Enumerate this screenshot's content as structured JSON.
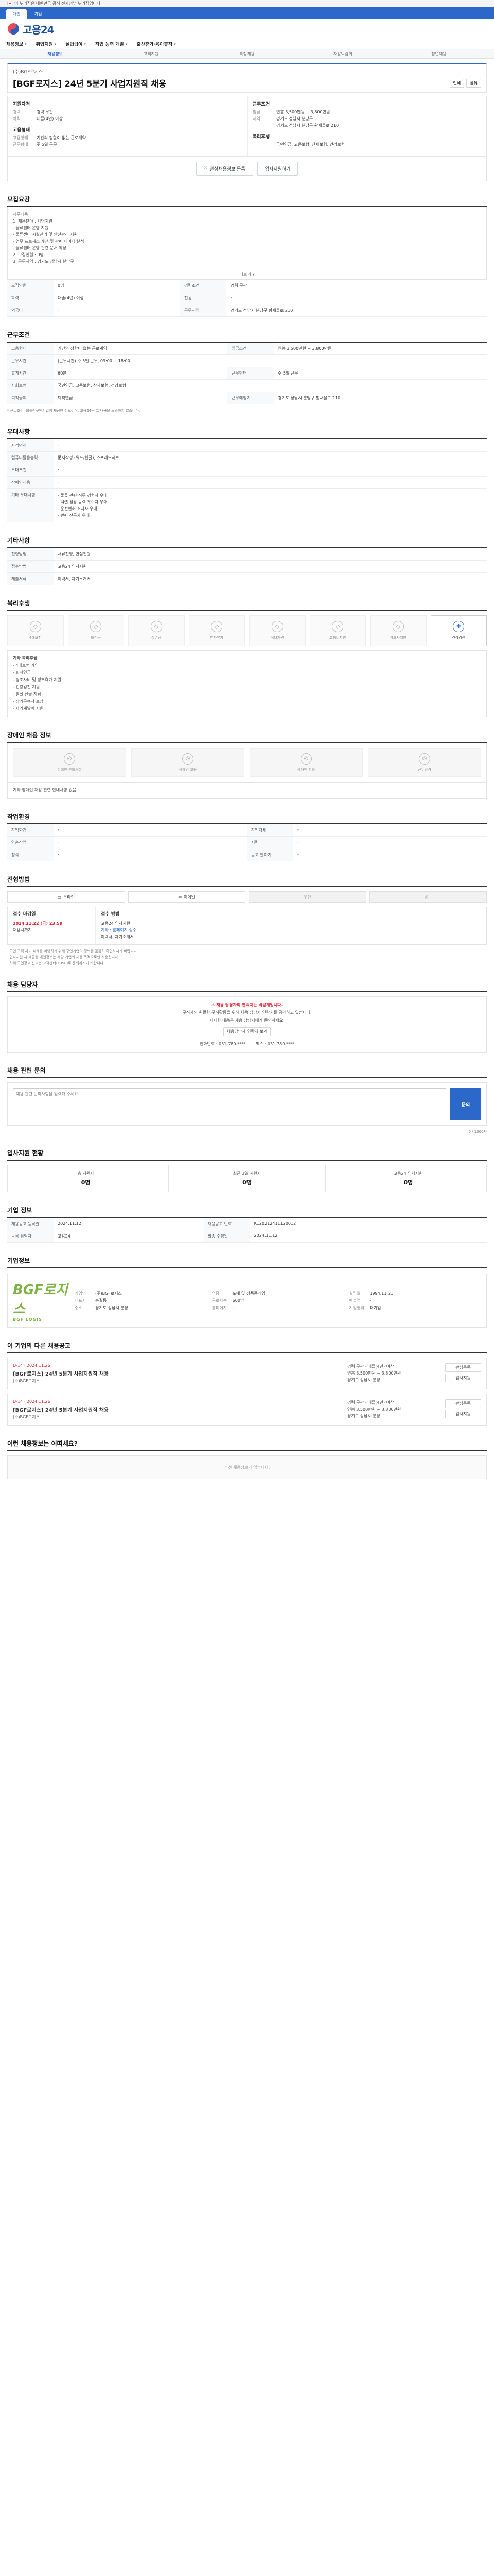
{
  "gov_banner": "이 누리집은 대한민국 공식 전자정부 누리집입니다.",
  "topnav": [
    "개인",
    "기업"
  ],
  "brand": {
    "logo_text": "고용24"
  },
  "mainmenu": [
    "채용정보",
    "취업지원",
    "실업급여",
    "직업 능력 개발",
    "출산휴가·육아휴직"
  ],
  "submenu": [
    "채용정보",
    "고객지원",
    "특정채용",
    "채용박람회",
    "청년채용"
  ],
  "job": {
    "company": "(주)BGF로지스",
    "title": "[BGF로지스] 24년 5분기 사업지원직 채용",
    "print": "인쇄",
    "share": "공유",
    "summary_left_title": "지원자격",
    "summary_left": [
      {
        "k": "경력",
        "v": "경력 무관"
      },
      {
        "k": "학력",
        "v": "대졸(4년) 이상"
      }
    ],
    "summary_right_title": "근무조건",
    "summary_right": [
      {
        "k": "임금",
        "v": "연봉 3,500만원 ~ 3,800만원"
      },
      {
        "k": "지역",
        "v": "경기도 성남시 분당구"
      },
      {
        "k": "",
        "v": "경기도 성남시 분당구 황새울로 210"
      }
    ],
    "summary_left2_title": "고용형태",
    "summary_left2": [
      {
        "k": "고용형태",
        "v": "기간의 정함이 없는 근로계약"
      },
      {
        "k": "근무형태",
        "v": "주 5일 근무"
      }
    ],
    "summary_right2_title": "복리후생",
    "summary_right2": [
      {
        "k": "",
        "v": "국민연금, 고용보험, 산재보험, 건강보험"
      }
    ],
    "btn_scrap": "관심채용정보 등록",
    "btn_apply": "입사지원하기"
  },
  "section_titles": {
    "notice": "모집요강",
    "conditions": "근무조건",
    "preference": "우대사항",
    "etc": "기타사항",
    "welfare": "복리후생",
    "disability": "장애인 채용 정보",
    "workplace": "작업환경",
    "apply": "전형방법",
    "contact": "채용 담당자",
    "inquiry": "채용 관련 문의",
    "stats": "입사지원 현황",
    "info": "기업 정보",
    "company": "기업정보",
    "others": "이 기업의 다른 채용공고",
    "similar": "이런 채용정보는 어떠세요?"
  },
  "notice": {
    "lines": [
      "직무내용",
      "1. 채용분야 : 사업지원",
      "  - 물류센터 운영 지원",
      "  - 물류센터 시설관리 및 안전관리 지원",
      "  - 업무 프로세스 개선 및 관련 데이터 분석",
      "  - 물류센터 운영 관련 문서 작성",
      "2. 모집인원 : 0명",
      "3. 근무지역 : 경기도 성남시 분당구"
    ],
    "more": "더보기"
  },
  "notice_table": [
    {
      "k": "모집인원",
      "v": "0명"
    },
    {
      "k": "경력조건",
      "v": "경력 무관"
    },
    {
      "k": "학력",
      "v": "대졸(4년) 이상"
    },
    {
      "k": "전공",
      "v": "-"
    },
    {
      "k": "외국어",
      "v": "-"
    },
    {
      "k": "근무지역",
      "v": "경기도 성남시 분당구 황새울로 210"
    }
  ],
  "conditions_table": [
    {
      "k": "고용형태",
      "v": "기간의 정함이 없는 근로계약"
    },
    {
      "k": "임금조건",
      "v": "연봉 3,500만원 ~ 3,800만원"
    },
    {
      "k": "근무시간",
      "v": "(근무시간) 주 5일 근무, 09:00 ~ 18:00"
    },
    {
      "k": "휴게시간",
      "v": "60분"
    },
    {
      "k": "근무형태",
      "v": "주 5일 근무"
    },
    {
      "k": "사회보험",
      "v": "국민연금, 고용보험, 산재보험, 건강보험"
    },
    {
      "k": "퇴직급여",
      "v": "퇴직연금"
    },
    {
      "k": "근무예정지",
      "v": "경기도 성남시 분당구 황새울로 210"
    }
  ],
  "conditions_note": "* 근로조건 내용은 구인기업이 제공한 정보이며, 고용24는 그 내용을 보증하지 않습니다.",
  "preference_table": [
    {
      "k": "자격면허",
      "v": "-"
    },
    {
      "k": "컴퓨터활용능력",
      "v": "문서작성 (워드/한글), 스프레드시트"
    },
    {
      "k": "우대조건",
      "v": "-"
    },
    {
      "k": "장애인채용",
      "v": "-"
    },
    {
      "k": "기타 우대사항",
      "v": "- 물류 관련 직무 경험자 우대\n- 엑셀 활용 능력 우수자 우대\n- 운전면허 소지자 우대\n- 관련 전공자 우대"
    }
  ],
  "etc_table": [
    {
      "k": "전형방법",
      "v": "서류전형, 면접전형"
    },
    {
      "k": "접수방법",
      "v": "고용24 입사지원"
    },
    {
      "k": "제출서류",
      "v": "이력서, 자기소개서"
    }
  ],
  "welfare_icons": [
    "4대보험",
    "퇴직금",
    "상여금",
    "연차휴가",
    "식대지원",
    "교통비지원",
    "경조사지원",
    "건강검진"
  ],
  "welfare_on_index": 7,
  "welfare_list": [
    "기타 복리후생",
    "- 4대보험 가입",
    "- 퇴직연금",
    "- 경조사비 및 경조휴가 지원",
    "- 건강검진 지원",
    "- 명절 선물 지급",
    "- 장기근속자 포상",
    "- 자기계발비 지원"
  ],
  "disability_cards": [
    "장애인 편의시설",
    "장애인 고용",
    "장애인 친화",
    "근무환경"
  ],
  "disability_note": "기타 장애인 채용 관련 안내사항 없음",
  "workplace_table": [
    {
      "k": "작업환경",
      "v": "-",
      "k2": "작업자세",
      "v2": "-"
    },
    {
      "k": "양손작업",
      "v": "-",
      "k2": "시력",
      "v2": "-"
    },
    {
      "k": "청각",
      "v": "-",
      "k2": "듣고 말하기",
      "v2": "-"
    }
  ],
  "apply_tabs": [
    "온라인",
    "이메일",
    "우편",
    "방문"
  ],
  "apply": {
    "period_title": "접수 마감일",
    "period": "2024.11.22 (금) 23:59",
    "period_note": "채용시까지",
    "method_title": "접수 방법",
    "method_lines": [
      "고용24 입사지원",
      "기타 : 홈페이지 접수",
      "이력서, 자기소개서"
    ],
    "notes": [
      "· 구인·구직 사기 피해를 예방하기 위해 구인기업의 정보를 꼼꼼히 확인하시기 바랍니다.",
      "· 입사지원 시 제출한 개인정보는 해당 기업의 채용 목적으로만 사용됩니다.",
      "· 허위 구인광고 신고는 고객센터(1350)로 문의하시기 바랍니다."
    ]
  },
  "contact": {
    "warn": "채용 담당자의 연락처는 비공개입니다.",
    "line1": "구직자의 원활한 구직활동을 위해 채용 담당자 연락처를 공개하고 있습니다.",
    "line2": "자세한 내용은 채용 담당자에게 문의하세요.",
    "btn": "채용담당자 연락처 보기",
    "phone": "전화번호 : 031-780-****",
    "fax": "팩스 : 031-780-****"
  },
  "inquiry": {
    "placeholder": "채용 관련 문의사항을 입력해 주세요.",
    "send": "문의",
    "count": "0 / 1000자"
  },
  "stats": [
    {
      "lbl": "총 지원자",
      "num": "0명"
    },
    {
      "lbl": "최근 3일 지원자",
      "num": "0명"
    },
    {
      "lbl": "고용24 입사지원",
      "num": "0명"
    }
  ],
  "info_table": [
    {
      "k": "채용공고 등록일",
      "v": "2024.11.12",
      "k2": "채용공고 번호",
      "v2": "K120212411120012"
    },
    {
      "k": "등록 담당자",
      "v": "고용24",
      "k2": "최종 수정일",
      "v2": "2024.11.12"
    }
  ],
  "company": {
    "logo": "BGF로지스",
    "logo_sub": "BGF LOGIS",
    "fields": [
      {
        "k": "기업명",
        "v": "(주)BGF로지스"
      },
      {
        "k": "업종",
        "v": "도매 및 상품중개업"
      },
      {
        "k": "설립일",
        "v": "1994.11.21"
      },
      {
        "k": "대표자",
        "v": "홍길동"
      },
      {
        "k": "근로자수",
        "v": "600명"
      },
      {
        "k": "매출액",
        "v": "-"
      },
      {
        "k": "주소",
        "v": "경기도 성남시 분당구"
      },
      {
        "k": "홈페이지",
        "v": "-"
      },
      {
        "k": "기업형태",
        "v": "대기업"
      }
    ]
  },
  "others": [
    {
      "d": "D-14 · 2024.11.26",
      "t": "[BGF로지스] 24년 5분기 사업지원직 채용",
      "c": "(주)BGF로지스",
      "lines": [
        "경력 무관 · 대졸(4년) 이상",
        "연봉 3,500만원 ~ 3,800만원",
        "경기도 성남시 분당구"
      ],
      "btn1": "관심등록",
      "btn2": "입사지원"
    },
    {
      "d": "D-14 · 2024.11.26",
      "t": "[BGF로지스] 24년 5분기 사업지원직 채용",
      "c": "(주)BGF로지스",
      "lines": [
        "경력 무관 · 대졸(4년) 이상",
        "연봉 3,500만원 ~ 3,800만원",
        "경기도 성남시 분당구"
      ],
      "btn1": "관심등록",
      "btn2": "입사지원"
    }
  ],
  "similar_empty": "추천 채용정보가 없습니다."
}
